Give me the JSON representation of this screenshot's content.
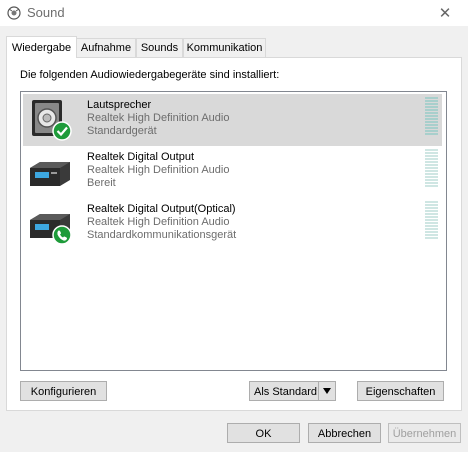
{
  "window": {
    "title": "Sound",
    "close_glyph": "✕"
  },
  "tabs": [
    {
      "label": "Wiedergabe",
      "active": true
    },
    {
      "label": "Aufnahme",
      "active": false
    },
    {
      "label": "Sounds",
      "active": false
    },
    {
      "label": "Kommunikation",
      "active": false
    }
  ],
  "caption": "Die folgenden Audiowiedergabegeräte sind installiert:",
  "devices": [
    {
      "name": "Lautsprecher",
      "driver": "Realtek High Definition Audio",
      "status": "Standardgerät",
      "icon": "speaker-icon",
      "badge": "check-badge-icon",
      "selected": true
    },
    {
      "name": "Realtek Digital Output",
      "driver": "Realtek High Definition Audio",
      "status": "Bereit",
      "icon": "digital-output-icon",
      "badge": null,
      "selected": false
    },
    {
      "name": "Realtek Digital Output(Optical)",
      "driver": "Realtek High Definition Audio",
      "status": "Standardkommunikationsgerät",
      "icon": "digital-output-icon",
      "badge": "phone-badge-icon",
      "selected": false
    }
  ],
  "buttons": {
    "configure": "Konfigurieren",
    "set_default": "Als Standard",
    "properties": "Eigenschaften",
    "ok": "OK",
    "cancel": "Abbrechen",
    "apply": "Übernehmen"
  },
  "colors": {
    "selection": "#d9d9d9",
    "badge_green": "#1e9b3a",
    "meter": "#a8cfcc"
  }
}
